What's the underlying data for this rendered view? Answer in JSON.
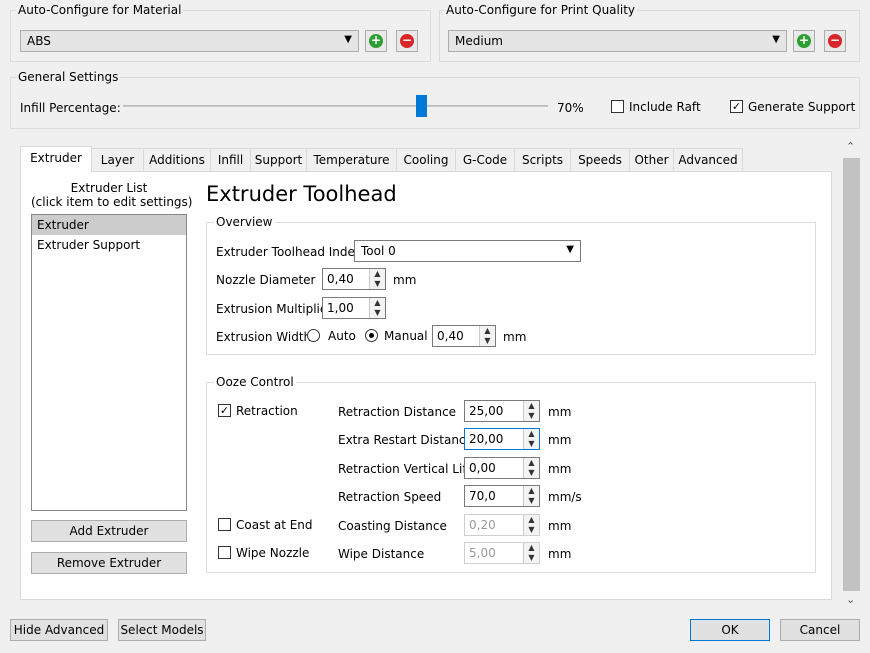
{
  "material": {
    "group_title": "Auto-Configure for Material",
    "selected": "ABS"
  },
  "quality": {
    "group_title": "Auto-Configure for Print Quality",
    "selected": "Medium"
  },
  "general": {
    "group_title": "General Settings",
    "infill_label": "Infill Percentage:",
    "infill_value_text": "70%",
    "infill_fraction": 0.7,
    "include_raft_label": "Include Raft",
    "include_raft_checked": false,
    "generate_support_label": "Generate Support",
    "generate_support_checked": true
  },
  "tabs": [
    "Extruder",
    "Layer",
    "Additions",
    "Infill",
    "Support",
    "Temperature",
    "Cooling",
    "G-Code",
    "Scripts",
    "Speeds",
    "Other",
    "Advanced"
  ],
  "active_tab": "Extruder",
  "extruder_list": {
    "title_line1": "Extruder List",
    "title_line2": "(click item to edit settings)",
    "items": [
      "Extruder",
      "Extruder Support"
    ],
    "selected_index": 0,
    "add_button": "Add Extruder",
    "remove_button": "Remove Extruder"
  },
  "panel": {
    "heading": "Extruder Toolhead",
    "overview": {
      "title": "Overview",
      "toolhead_index_label": "Extruder Toolhead Index",
      "toolhead_index_value": "Tool 0",
      "nozzle_label": "Nozzle Diameter",
      "nozzle_value": "0,40",
      "nozzle_unit": "mm",
      "multiplier_label": "Extrusion Multiplier",
      "multiplier_value": "1,00",
      "width_label": "Extrusion Width",
      "width_auto_label": "Auto",
      "width_manual_label": "Manual",
      "width_value": "0,40",
      "width_unit": "mm"
    },
    "ooze": {
      "title": "Ooze Control",
      "retraction_label": "Retraction",
      "retraction_checked": true,
      "coast_label": "Coast at End",
      "coast_checked": false,
      "wipe_label": "Wipe Nozzle",
      "wipe_checked": false,
      "fields": [
        {
          "label": "Retraction Distance",
          "value": "25,00",
          "unit": "mm",
          "disabled": false
        },
        {
          "label": "Extra Restart Distance",
          "value": "20,00",
          "unit": "mm",
          "disabled": false
        },
        {
          "label": "Retraction Vertical Lift",
          "value": "0,00",
          "unit": "mm",
          "disabled": false
        },
        {
          "label": "Retraction Speed",
          "value": "70,0",
          "unit": "mm/s",
          "disabled": false
        },
        {
          "label": "Coasting Distance",
          "value": "0,20",
          "unit": "mm",
          "disabled": true
        },
        {
          "label": "Wipe Distance",
          "value": "5,00",
          "unit": "mm",
          "disabled": true
        }
      ]
    }
  },
  "footer": {
    "hide_advanced": "Hide Advanced",
    "select_models": "Select Models",
    "ok": "OK",
    "cancel": "Cancel"
  },
  "icons": {
    "scroll_up": "chevron-up-icon",
    "scroll_down": "chevron-down-icon",
    "dropdown": "dropdown-arrow-icon",
    "add": "plus-icon",
    "remove": "minus-icon"
  },
  "colors": {
    "accent": "#0078d7",
    "add_green": "#2f9e33",
    "remove_red": "#d9262b"
  }
}
